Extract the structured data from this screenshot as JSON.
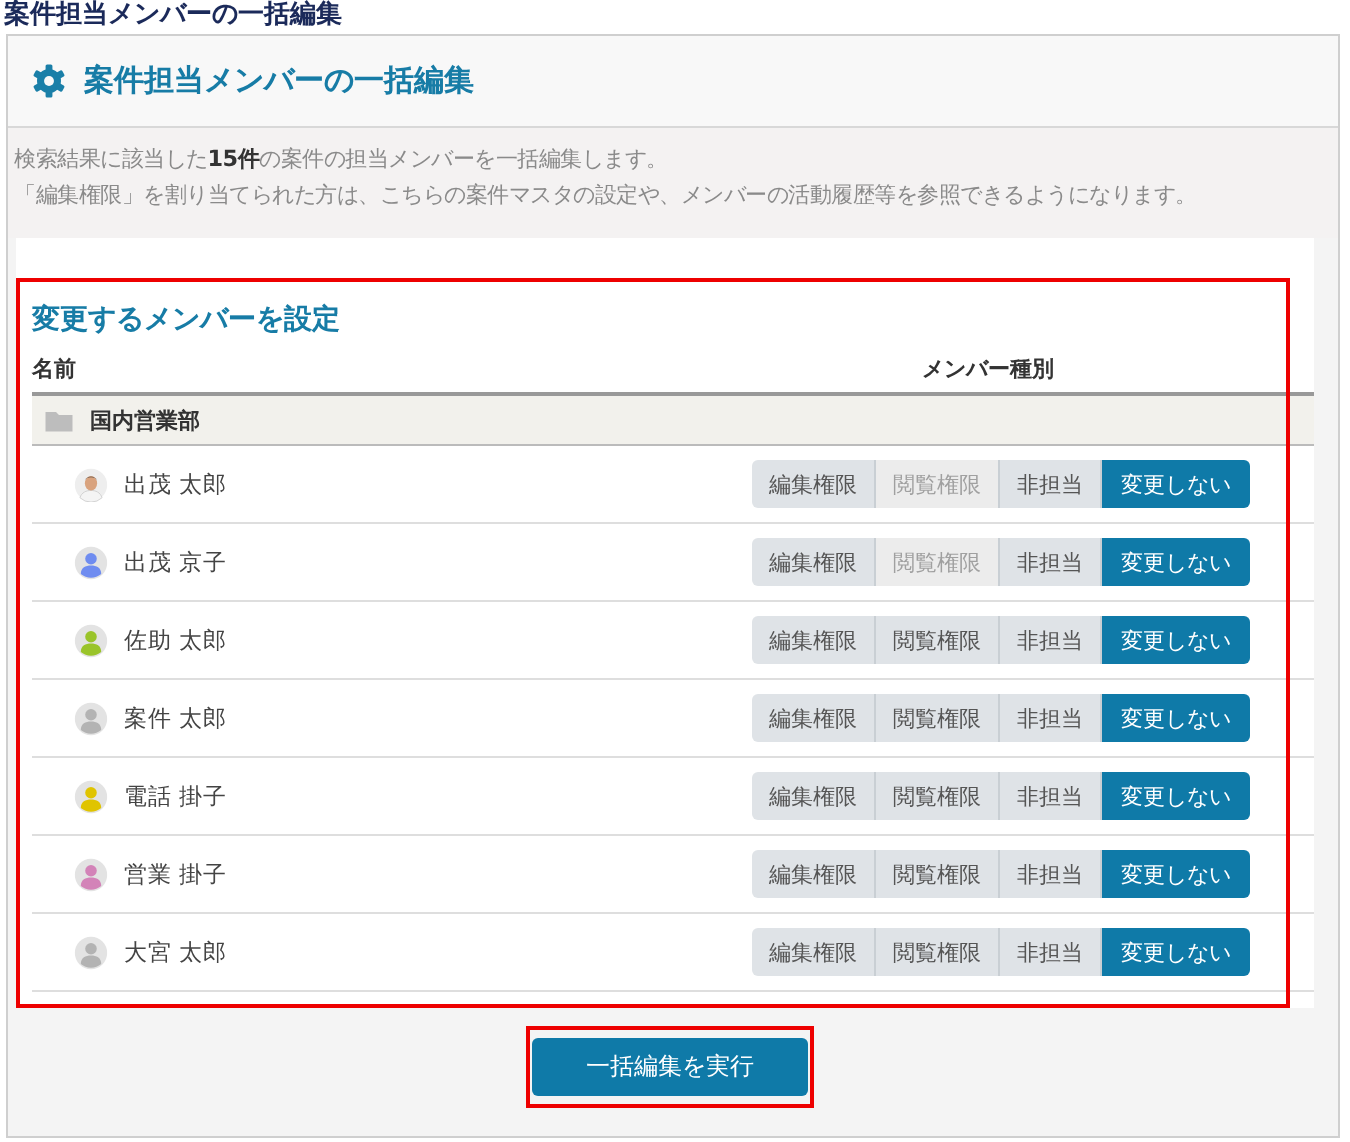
{
  "page_title": "案件担当メンバーの一括編集",
  "panel": {
    "title": "案件担当メンバーの一括編集",
    "description": [
      "検索結果に該当した**15件**の案件の担当メンバーを一括編集します。",
      "「編集権限」を割り当てられた方は、こちらの案件マスタの設定や、メンバーの活動履歴等を参照できるようになります。"
    ],
    "section": {
      "title": "変更するメンバーを設定",
      "highlighted": true,
      "columns": [
        "名前",
        "メンバー種別"
      ],
      "group": {
        "name": "国内営業部"
      },
      "members": [
        {
          "name": "出茂 太郎",
          "kind": "photo",
          "options": [
            {
              "label": "編集権限",
              "selected": false,
              "disabled": false
            },
            {
              "label": "閲覧権限",
              "selected": false,
              "disabled": true
            },
            {
              "label": "非担当",
              "selected": false,
              "disabled": false
            },
            {
              "label": "変更しない",
              "selected": true,
              "disabled": false
            }
          ]
        },
        {
          "name": "出茂 京子",
          "kind": "silhouette",
          "color": "#6f8cf0",
          "options": [
            {
              "label": "編集権限",
              "selected": false,
              "disabled": false
            },
            {
              "label": "閲覧権限",
              "selected": false,
              "disabled": true
            },
            {
              "label": "非担当",
              "selected": false,
              "disabled": false
            },
            {
              "label": "変更しない",
              "selected": true,
              "disabled": false
            }
          ]
        },
        {
          "name": "佐助 太郎",
          "kind": "silhouette",
          "color": "#9ac42a",
          "options": [
            {
              "label": "編集権限",
              "selected": false,
              "disabled": false
            },
            {
              "label": "閲覧権限",
              "selected": false,
              "disabled": false
            },
            {
              "label": "非担当",
              "selected": false,
              "disabled": false
            },
            {
              "label": "変更しない",
              "selected": true,
              "disabled": false
            }
          ]
        },
        {
          "name": "案件 太郎",
          "kind": "silhouette",
          "color": "#b3b3b3",
          "options": [
            {
              "label": "編集権限",
              "selected": false,
              "disabled": false
            },
            {
              "label": "閲覧権限",
              "selected": false,
              "disabled": false
            },
            {
              "label": "非担当",
              "selected": false,
              "disabled": false
            },
            {
              "label": "変更しない",
              "selected": true,
              "disabled": false
            }
          ]
        },
        {
          "name": "電話 掛子",
          "kind": "silhouette",
          "color": "#e0c400",
          "options": [
            {
              "label": "編集権限",
              "selected": false,
              "disabled": false
            },
            {
              "label": "閲覧権限",
              "selected": false,
              "disabled": false
            },
            {
              "label": "非担当",
              "selected": false,
              "disabled": false
            },
            {
              "label": "変更しない",
              "selected": true,
              "disabled": false
            }
          ]
        },
        {
          "name": "営業 掛子",
          "kind": "silhouette",
          "color": "#d383b8",
          "options": [
            {
              "label": "編集権限",
              "selected": false,
              "disabled": false
            },
            {
              "label": "閲覧権限",
              "selected": false,
              "disabled": false
            },
            {
              "label": "非担当",
              "selected": false,
              "disabled": false
            },
            {
              "label": "変更しない",
              "selected": true,
              "disabled": false
            }
          ]
        },
        {
          "name": "大宮 太郎",
          "kind": "silhouette",
          "color": "#b3b3b3",
          "options": [
            {
              "label": "編集権限",
              "selected": false,
              "disabled": false
            },
            {
              "label": "閲覧権限",
              "selected": false,
              "disabled": false
            },
            {
              "label": "非担当",
              "selected": false,
              "disabled": false
            },
            {
              "label": "変更しない",
              "selected": true,
              "disabled": false
            }
          ]
        }
      ]
    },
    "submit": {
      "label": "一括編集を実行",
      "highlighted": true
    }
  }
}
